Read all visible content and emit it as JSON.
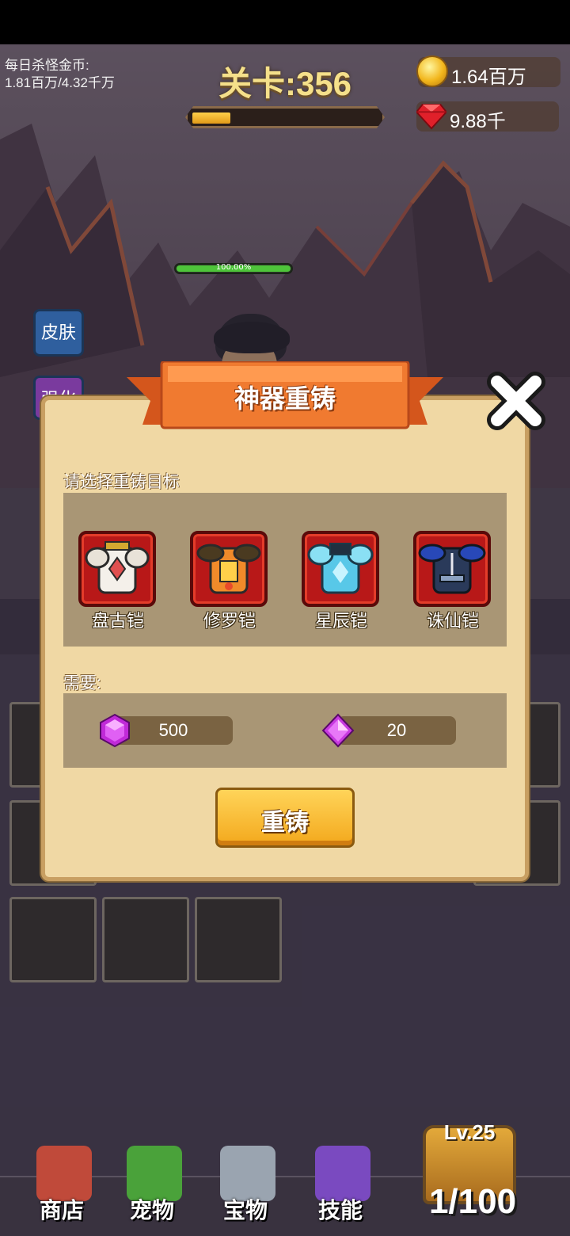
{
  "hud": {
    "daily_kill_label": "每日杀怪金币:",
    "daily_kill_value": "1.81百万/4.32千万",
    "stage_label": "关卡:356",
    "stage_progress": 0.2,
    "coins": "1.64百万",
    "gems": "9.88千",
    "coin_icon": "gold-coin-icon",
    "gem_icon": "ruby-icon"
  },
  "scene": {
    "hero_hp_text": "100.00%",
    "hero_hp_fraction": 1.0,
    "side_buttons": [
      {
        "label": "皮肤",
        "color": "#2f5f9e"
      },
      {
        "label": "强化",
        "color": "#7a3a9e"
      }
    ]
  },
  "dialog": {
    "title": "神器重铸",
    "select_prompt": "请选择重铸目标",
    "items": [
      {
        "name": "盘古铠",
        "icon": "white-gold-armor-icon"
      },
      {
        "name": "修罗铠",
        "icon": "orange-armor-icon"
      },
      {
        "name": "星辰铠",
        "icon": "ice-blue-armor-icon"
      },
      {
        "name": "诛仙铠",
        "icon": "dark-blue-armor-icon"
      }
    ],
    "requires_label": "需要:",
    "requirements": [
      {
        "value": "500",
        "icon": "purple-hexagon-gem-icon"
      },
      {
        "value": "20",
        "icon": "purple-diamond-gem-icon"
      }
    ],
    "recast_button": "重铸"
  },
  "nav": {
    "items": [
      {
        "label": "商店",
        "icon": "shop-icon",
        "color": "#c04a3a"
      },
      {
        "label": "宠物",
        "icon": "pet-cactus-icon",
        "color": "#4aa23a"
      },
      {
        "label": "宝物",
        "icon": "crossed-swords-icon",
        "color": "#9aa4b0"
      },
      {
        "label": "技能",
        "icon": "skill-book-icon",
        "color": "#7a4ac0"
      }
    ],
    "chest_level": "Lv.25",
    "chest_count": "1/100"
  }
}
